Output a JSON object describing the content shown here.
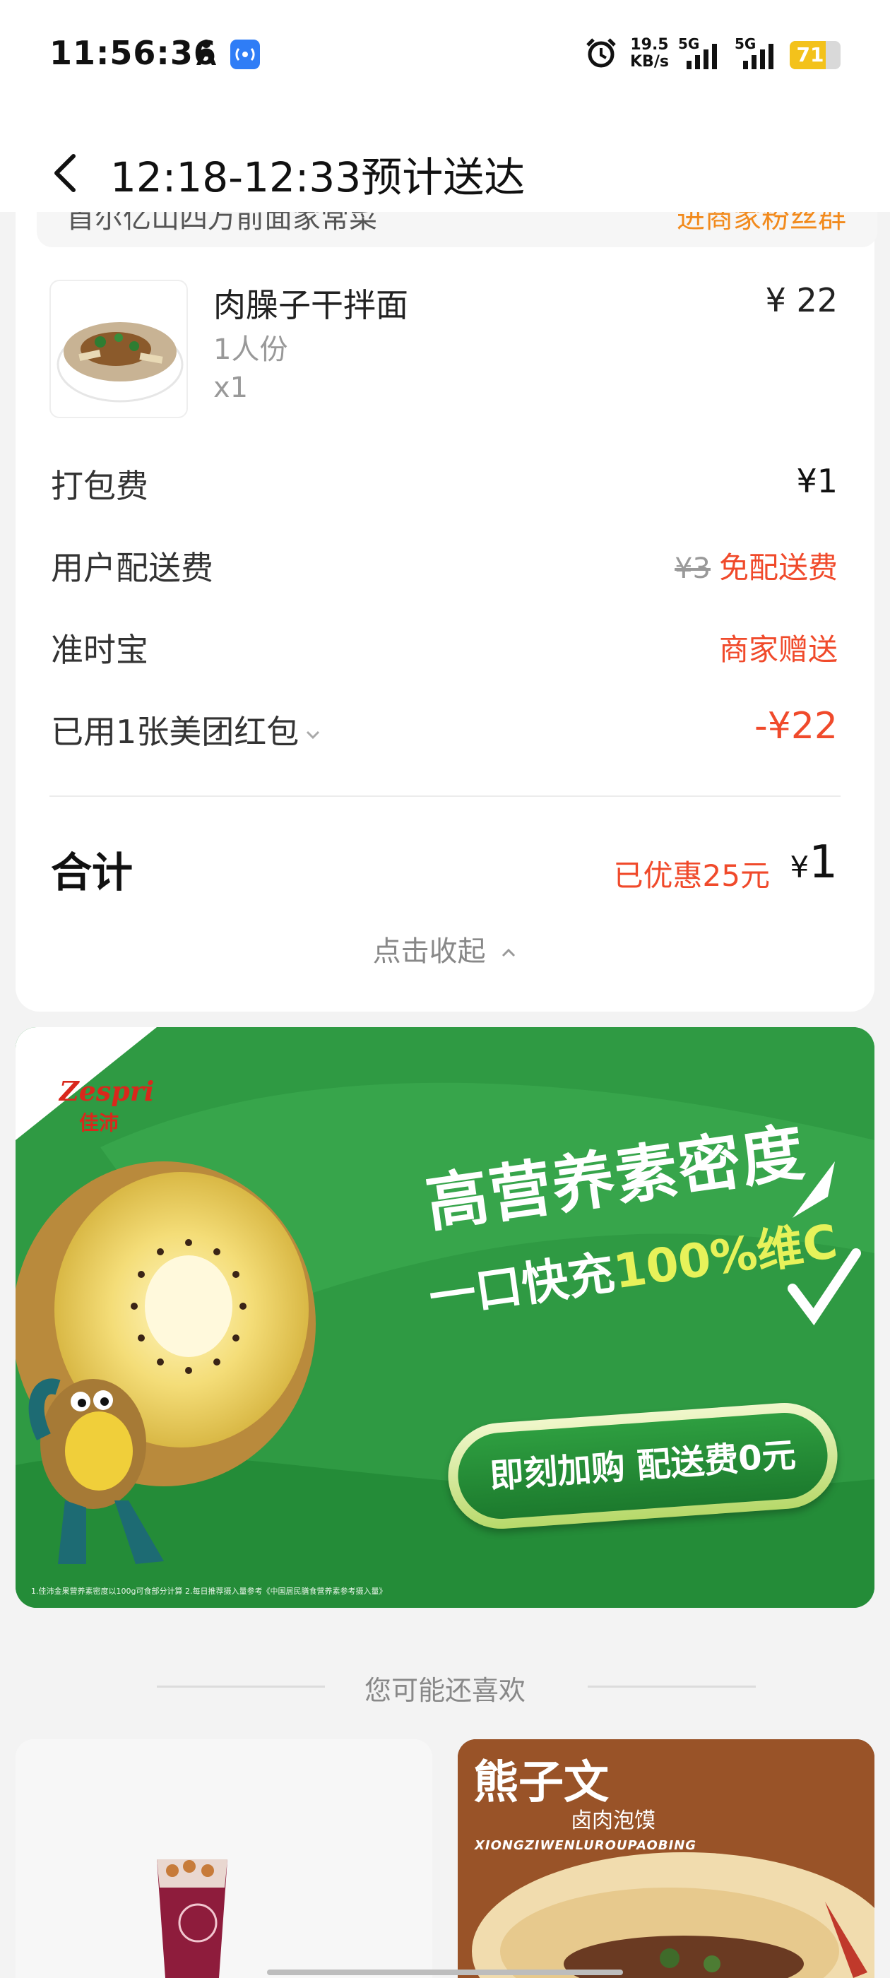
{
  "status_bar": {
    "time": "11:56:36",
    "speed_value": "19.5",
    "speed_unit": "KB/s",
    "network_1": "5G",
    "network_2": "5G",
    "battery": "71",
    "battery_level": 0.71,
    "icons": [
      "person-icon",
      "hotspot-icon",
      "alarm-icon",
      "signal-icon",
      "battery-icon"
    ]
  },
  "header": {
    "title": "12:18-12:33预计送达",
    "back_icon": "chevron-left-icon"
  },
  "shop": {
    "name": "首尔亿山四万前面家常菜",
    "fans_link": "进商家粉丝群"
  },
  "item": {
    "name": "肉臊子干拌面",
    "portion": "1人份",
    "quantity": "x1",
    "price": "¥ 22"
  },
  "fees": {
    "packing_label": "打包费",
    "packing_value": "¥1",
    "delivery_label": "用户配送费",
    "delivery_original": "¥3",
    "delivery_value": "免配送费",
    "ontime_label": "准时宝",
    "ontime_value": "商家赠送",
    "coupon_label": "已用1张美团红包",
    "coupon_value": "-¥22"
  },
  "total": {
    "label": "合计",
    "discount": "已优惠25元",
    "currency": "¥",
    "amount": "1",
    "collapse": "点击收起"
  },
  "banner": {
    "brand_en": "Zespri",
    "brand_cn": "佳沛",
    "headline": "高营养素密度",
    "sub_prefix": "一口快充",
    "sub_highlight": "100%维C",
    "cta": "即刻加购 配送费0元",
    "fine_print": "1.佳沛金果营养素密度以100g可食部分计算 2.每日推荐摄入量参考《中国居民膳食营养素参考摄入量》"
  },
  "recommend": {
    "title": "您可能还喜欢",
    "card_right_brand": "熊子文",
    "card_right_sub": "卤肉泡馍",
    "card_right_en": "XIONGZIWENLUROUPAOBING"
  },
  "colors": {
    "accent_red": "#f04a2b",
    "accent_orange": "#f28a1c",
    "banner_green": "#2f9a43"
  }
}
